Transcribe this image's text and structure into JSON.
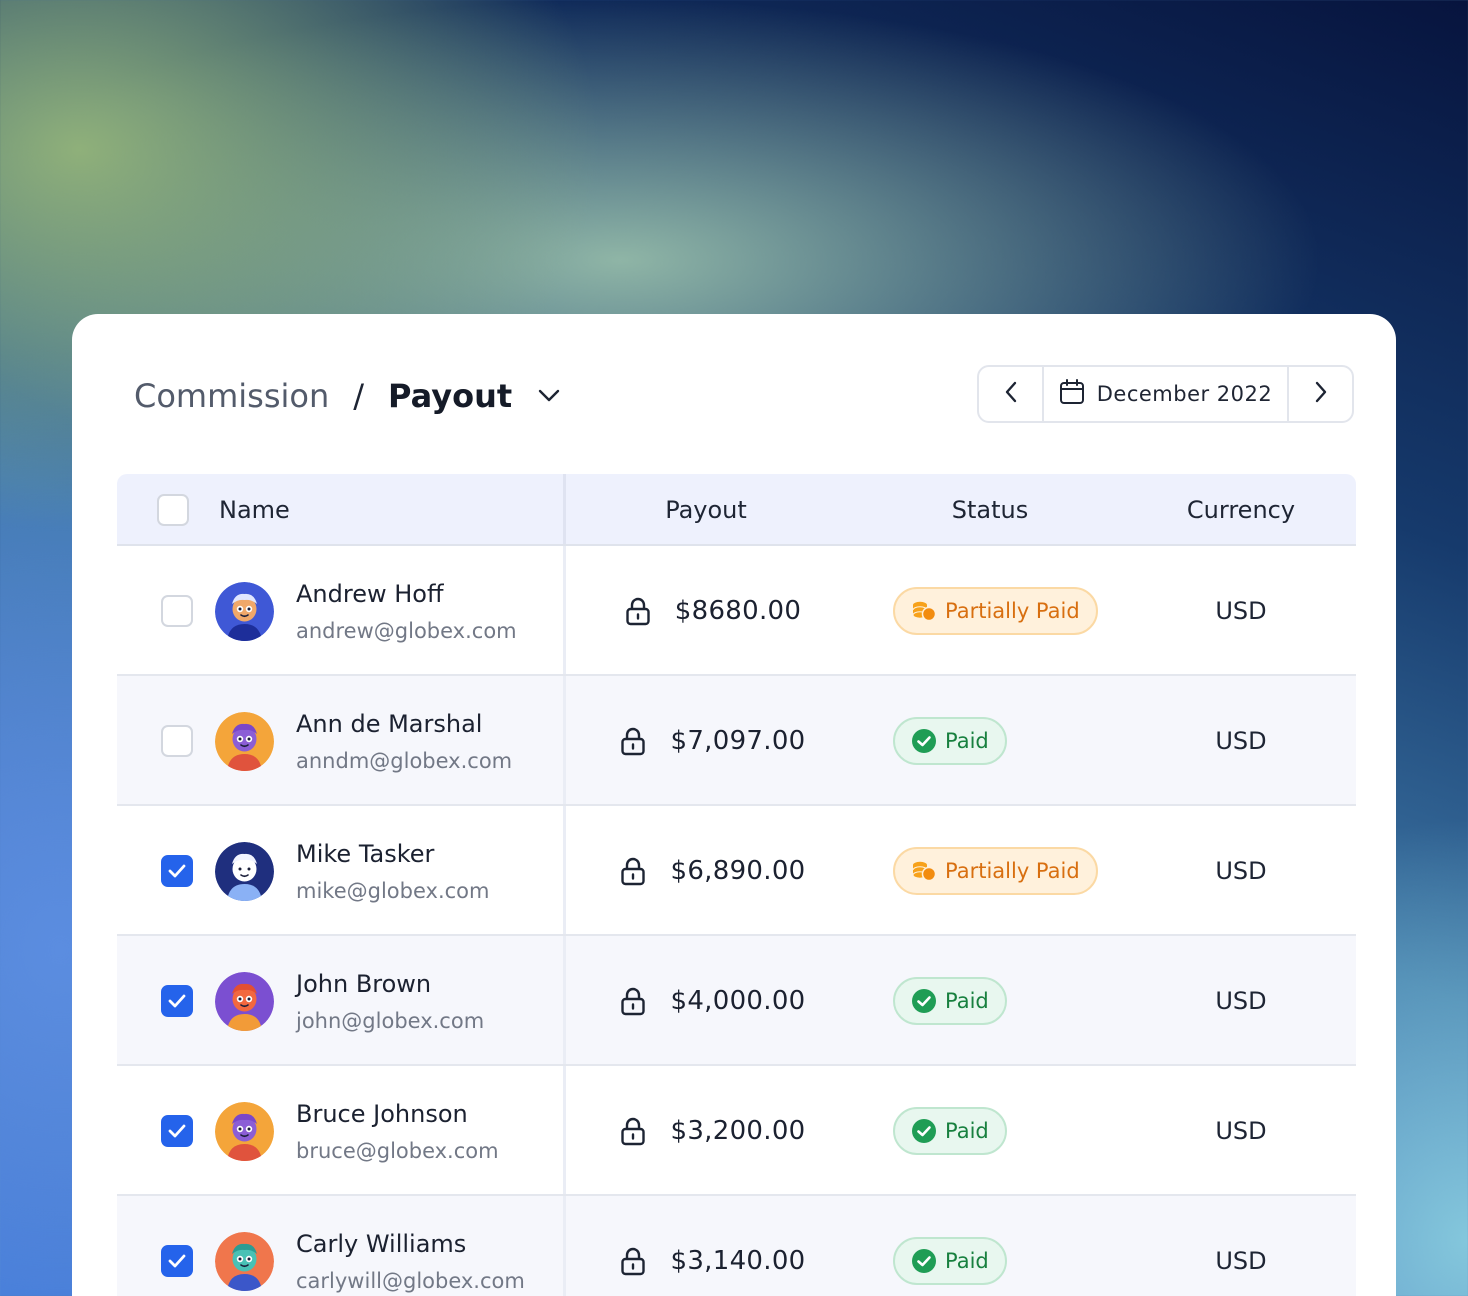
{
  "breadcrumb": {
    "root": "Commission",
    "separator": "/",
    "current": "Payout"
  },
  "date_nav": {
    "label": "December 2022"
  },
  "table": {
    "columns": {
      "name": "Name",
      "payout": "Payout",
      "status": "Status",
      "currency": "Currency"
    },
    "rows": [
      {
        "name": "Andrew Hoff",
        "email": "andrew@globex.com",
        "payout": "$8680.00",
        "status": "Partially Paid",
        "status_type": "partial",
        "currency": "USD",
        "checked": false,
        "avatar": "blue"
      },
      {
        "name": "Ann de Marshal",
        "email": "anndm@globex.com",
        "payout": "$7,097.00",
        "status": "Paid",
        "status_type": "paid",
        "currency": "USD",
        "checked": false,
        "avatar": "orange"
      },
      {
        "name": "Mike Tasker",
        "email": "mike@globex.com",
        "payout": "$6,890.00",
        "status": "Partially Paid",
        "status_type": "partial",
        "currency": "USD",
        "checked": true,
        "avatar": "navy"
      },
      {
        "name": "John Brown",
        "email": "john@globex.com",
        "payout": "$4,000.00",
        "status": "Paid",
        "status_type": "paid",
        "currency": "USD",
        "checked": true,
        "avatar": "purple"
      },
      {
        "name": "Bruce Johnson",
        "email": "bruce@globex.com",
        "payout": "$3,200.00",
        "status": "Paid",
        "status_type": "paid",
        "currency": "USD",
        "checked": true,
        "avatar": "orange"
      },
      {
        "name": "Carly Williams",
        "email": "carlywill@globex.com",
        "payout": "$3,140.00",
        "status": "Paid",
        "status_type": "paid",
        "currency": "USD",
        "checked": true,
        "avatar": "coral"
      }
    ]
  },
  "colors": {
    "accent": "#2563eb",
    "partial": "#d86f10",
    "paid": "#18803f"
  }
}
